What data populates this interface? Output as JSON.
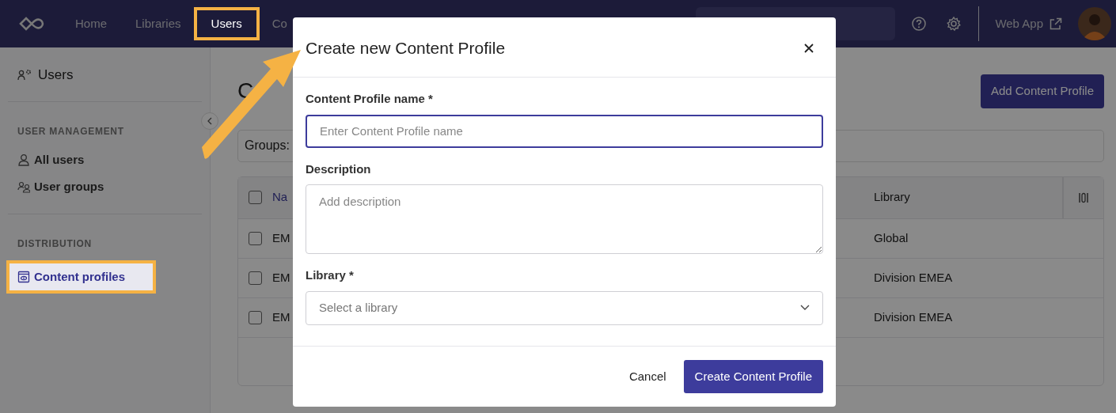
{
  "nav": {
    "items": [
      {
        "label": "Home",
        "selected": false,
        "highlighted": false
      },
      {
        "label": "Libraries",
        "selected": false,
        "highlighted": false
      },
      {
        "label": "Users",
        "selected": true,
        "highlighted": true
      },
      {
        "label": "Co",
        "selected": false,
        "highlighted": false
      }
    ],
    "web_app": "Web App"
  },
  "sidebar": {
    "title": "Users",
    "sections": [
      {
        "heading": "USER MANAGEMENT",
        "items": [
          {
            "label": "All users",
            "selected": false,
            "highlighted": false
          },
          {
            "label": "User groups",
            "selected": false,
            "highlighted": false
          }
        ]
      },
      {
        "heading": "DISTRIBUTION",
        "items": [
          {
            "label": "Content profiles",
            "selected": true,
            "highlighted": true
          }
        ]
      }
    ]
  },
  "page": {
    "title": "C",
    "add_button": "Add Content Profile",
    "filter": "Groups:",
    "table": {
      "columns": [
        "Na",
        "Library"
      ],
      "header_checked": false,
      "rows": [
        {
          "name": "EM",
          "library": "Global",
          "checked": false
        },
        {
          "name": "EM",
          "library": "Division EMEA",
          "checked": false
        },
        {
          "name": "EM",
          "library": "Division EMEA",
          "checked": false
        }
      ]
    }
  },
  "modal": {
    "title": "Create new Content Profile",
    "fields": [
      {
        "kind": "input",
        "label": "Content Profile name *",
        "placeholder": "Enter Content Profile name",
        "focused": true
      },
      {
        "kind": "textarea",
        "label": "Description",
        "placeholder": "Add description",
        "focused": false
      },
      {
        "kind": "select",
        "label": "Library *",
        "placeholder": "Select a library",
        "focused": false
      }
    ],
    "cancel": "Cancel",
    "submit": "Create Content Profile"
  }
}
